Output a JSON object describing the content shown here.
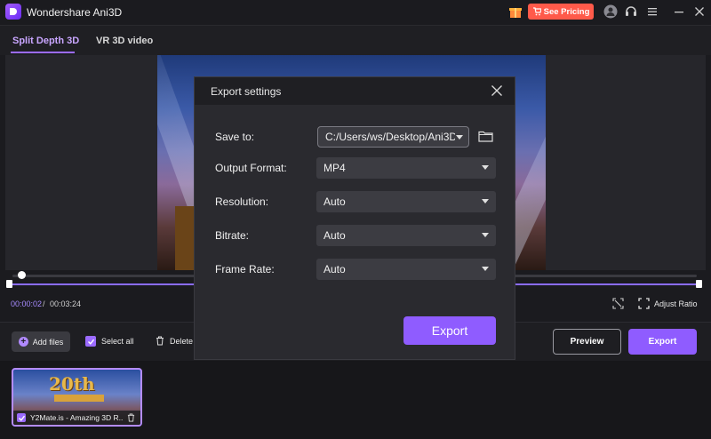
{
  "app": {
    "title": "Wondershare Ani3D",
    "pricing_label": "See Pricing"
  },
  "tabs": [
    {
      "label": "Split Depth 3D",
      "active": true
    },
    {
      "label": "VR 3D video",
      "active": false
    }
  ],
  "player": {
    "current_time": "00:00:02",
    "separator": "/",
    "total_time": "00:03:24",
    "adjust_ratio_label": "Adjust Ratio"
  },
  "toolbar": {
    "add_files_label": "Add files",
    "select_all_label": "Select all",
    "delete_label": "Delete",
    "preview_label": "Preview",
    "export_label": "Export"
  },
  "files": [
    {
      "name": "Y2Mate.is - Amazing 3D R...",
      "thumb_text": "20th",
      "checked": true
    }
  ],
  "dialog": {
    "title": "Export settings",
    "save_to_label": "Save to:",
    "save_to_value": "C:/Users/ws/Desktop/Ani3D",
    "output_format_label": "Output Format:",
    "output_format_value": "MP4",
    "resolution_label": "Resolution:",
    "resolution_value": "Auto",
    "bitrate_label": "Bitrate:",
    "bitrate_value": "Auto",
    "frame_rate_label": "Frame Rate:",
    "frame_rate_value": "Auto",
    "export_label": "Export"
  },
  "colors": {
    "accent": "#8f5cff",
    "pricing": "#ff5a4a",
    "background": "#1b1b1f",
    "dialog": "#2a2a2f"
  }
}
